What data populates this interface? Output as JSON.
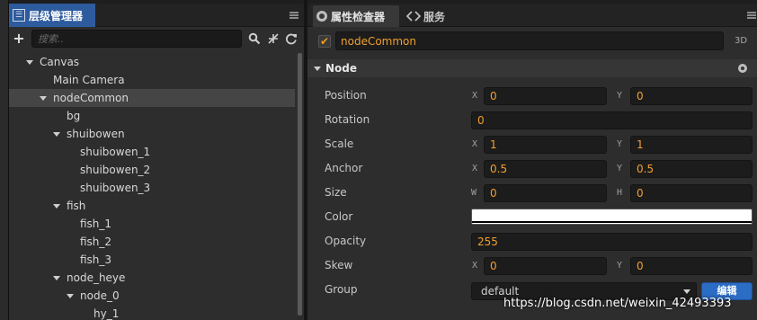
{
  "hierarchy": {
    "tab_title": "层级管理器",
    "search_placeholder": "搜索..",
    "tree": [
      {
        "label": "Canvas",
        "expanded": true
      },
      {
        "label": "Main Camera"
      },
      {
        "label": "nodeCommon",
        "expanded": true,
        "selected": true
      },
      {
        "label": "bg"
      },
      {
        "label": "shuibowen",
        "expanded": true
      },
      {
        "label": "shuibowen_1"
      },
      {
        "label": "shuibowen_2"
      },
      {
        "label": "shuibowen_3"
      },
      {
        "label": "fish",
        "expanded": true
      },
      {
        "label": "fish_1"
      },
      {
        "label": "fish_2"
      },
      {
        "label": "fish_3"
      },
      {
        "label": "node_heye",
        "expanded": true
      },
      {
        "label": "node_0",
        "expanded": true
      },
      {
        "label": "hy_1"
      }
    ]
  },
  "inspector": {
    "tab_title": "属性检查器",
    "services_tab": "服务",
    "node_name": "nodeCommon",
    "mode_label": "3D",
    "component_title": "Node",
    "props": {
      "position": {
        "label": "Position",
        "x_axis": "X",
        "y_axis": "Y",
        "x": "0",
        "y": "0"
      },
      "rotation": {
        "label": "Rotation",
        "value": "0"
      },
      "scale": {
        "label": "Scale",
        "x_axis": "X",
        "y_axis": "Y",
        "x": "1",
        "y": "1"
      },
      "anchor": {
        "label": "Anchor",
        "x_axis": "X",
        "y_axis": "Y",
        "x": "0.5",
        "y": "0.5"
      },
      "size": {
        "label": "Size",
        "w_axis": "W",
        "h_axis": "H",
        "w": "0",
        "h": "0"
      },
      "color": {
        "label": "Color",
        "value": "#ffffff"
      },
      "opacity": {
        "label": "Opacity",
        "value": "255"
      },
      "skew": {
        "label": "Skew",
        "x_axis": "X",
        "y_axis": "Y",
        "x": "0",
        "y": "0"
      },
      "group": {
        "label": "Group",
        "value": "default",
        "edit_label": "编辑"
      }
    }
  },
  "watermark": "https://blog.csdn.net/weixin_42493393",
  "colors": {
    "accent": "#2d5b9e",
    "value_text": "#f0a030",
    "edit_button": "#2b6cc4"
  }
}
